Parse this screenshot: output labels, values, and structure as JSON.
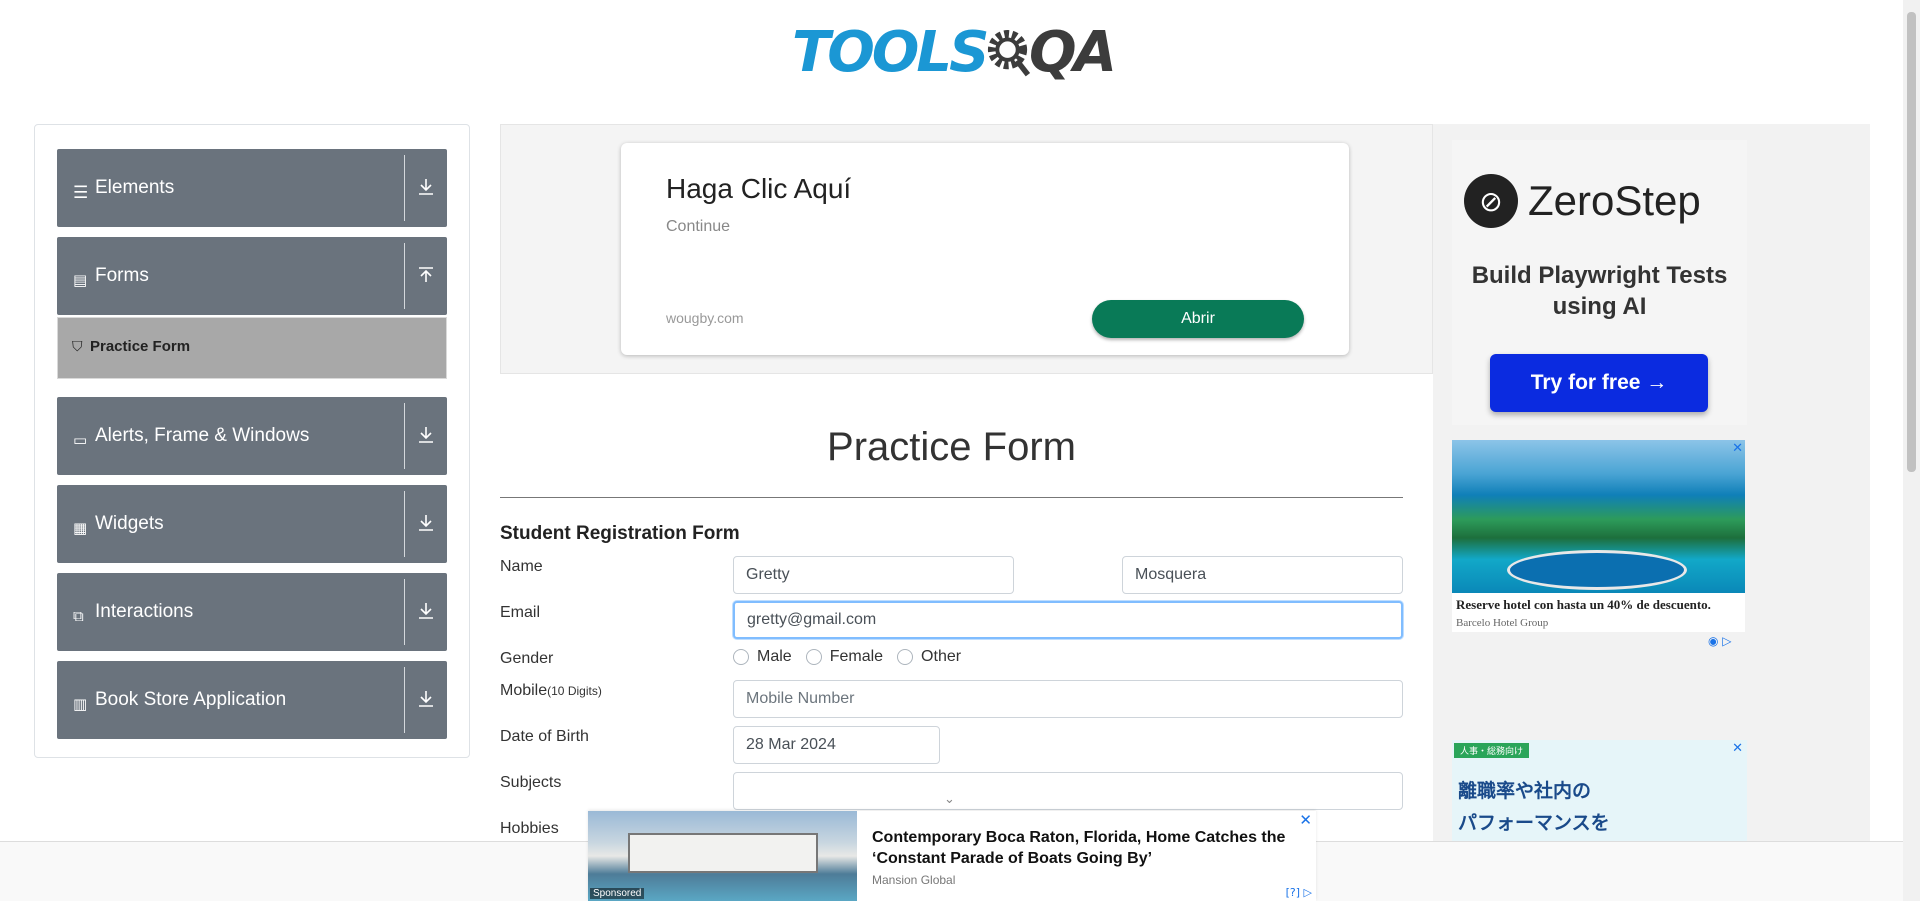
{
  "header": {
    "logo_tools": "TOOLS",
    "logo_qa": "QA"
  },
  "sidebar": {
    "groups": [
      {
        "label": "Elements",
        "icon": "list-icon",
        "state": "collapsed"
      },
      {
        "label": "Forms",
        "icon": "document-icon",
        "state": "expanded"
      },
      {
        "label": "Alerts, Frame & Windows",
        "icon": "window-icon",
        "state": "collapsed"
      },
      {
        "label": "Widgets",
        "icon": "widgets-icon",
        "state": "collapsed"
      },
      {
        "label": "Interactions",
        "icon": "interaction-icon",
        "state": "collapsed"
      },
      {
        "label": "Book Store Application",
        "icon": "books-icon",
        "state": "collapsed"
      }
    ],
    "active_item": "Practice Form"
  },
  "banner_ad": {
    "title": "Haga Clic Aquí",
    "subtitle": "Continue",
    "domain": "wougby.com",
    "button": "Abrir"
  },
  "form": {
    "page_title": "Practice Form",
    "form_title": "Student Registration Form",
    "name_label": "Name",
    "first_name": "Gretty",
    "last_name": "Mosquera",
    "email_label": "Email",
    "email_value": "gretty@gmail.com",
    "gender_label": "Gender",
    "gender_options": [
      "Male",
      "Female",
      "Other"
    ],
    "mobile_label": "Mobile",
    "mobile_hint": "(10 Digits)",
    "mobile_placeholder": "Mobile Number",
    "dob_label": "Date of Birth",
    "dob_value": "28 Mar 2024",
    "subjects_label": "Subjects",
    "hobbies_label": "Hobbies"
  },
  "right_ads": {
    "zerostep": {
      "brand": "ZeroStep",
      "tagline": "Build Playwright Tests using AI",
      "button": "Try for free →"
    },
    "hotel": {
      "title": "Reserve hotel con hasta un 40% de descuento.",
      "source": "Barcelo Hotel Group"
    },
    "japanese": {
      "tag": "人事・総務向け",
      "line1": "離職率や社内の",
      "line2": "パフォーマンスを"
    }
  },
  "sticky_ad": {
    "label": "Sponsored",
    "title": "Contemporary Boca Raton, Florida, Home Catches the ‘Constant Parade of Boats Going By’",
    "source": "Mansion Global",
    "choice": "[?]"
  },
  "colors": {
    "sidebar_group": "#6a737d",
    "practice_active": "#a8a8a8",
    "logo_blue": "#1b97d4",
    "abrir_green": "#097a57",
    "zerostep_blue": "#0b2be0"
  }
}
